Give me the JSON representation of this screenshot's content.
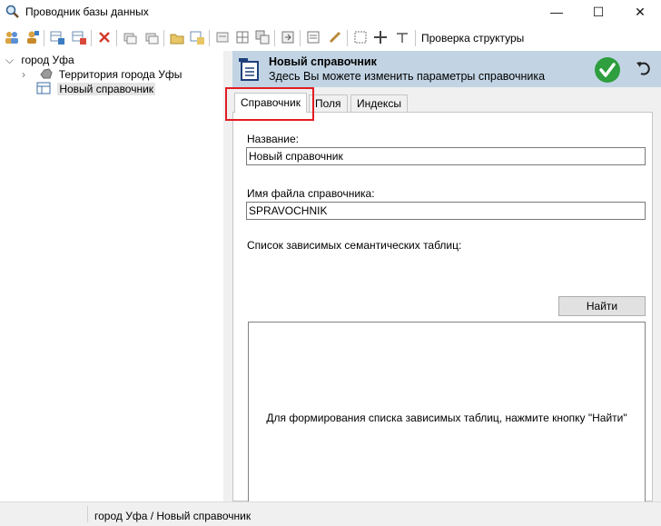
{
  "window": {
    "title": "Проводник базы данных",
    "minimize": "—",
    "maximize": "☐",
    "close": "✕"
  },
  "toolbar": {
    "check_structure_label": "Проверка структуры",
    "buttons": [
      "users-icon",
      "user-add-icon",
      "table-add-icon",
      "table-remove-icon",
      "delete-icon",
      "copy-icon",
      "copy-alt-icon",
      "folder-icon",
      "refresh-icon",
      "edit-icon",
      "grid-icon",
      "layers-icon",
      "export-icon",
      "list-icon",
      "pencil-icon",
      "crop-icon",
      "plus-icon",
      "filter-icon"
    ]
  },
  "tree": {
    "root_label": "город Уфа",
    "child1_label": "Территория города Уфы",
    "child2_label": "Новый справочник"
  },
  "header": {
    "title": "Новый справочник",
    "subtitle": "Здесь Вы можете изменить параметры справочника"
  },
  "tabs": {
    "tab1": "Справочник",
    "tab2": "Поля",
    "tab3": "Индексы"
  },
  "form": {
    "name_label": "Название:",
    "name_value": "Новый справочник",
    "file_label": "Имя файла справочника:",
    "file_value": "SPRAVOCHNIK",
    "list_label": "Список зависимых семантических таблиц:",
    "find_button": "Найти",
    "list_message": "Для формирования списка зависимых таблиц, нажмите кнопку \"Найти\""
  },
  "statusbar": {
    "path": "город Уфа / Новый справочник"
  },
  "colors": {
    "header_bg": "#c2d4e4",
    "highlight": "#e21c22",
    "ok_green": "#2e9e3e"
  }
}
